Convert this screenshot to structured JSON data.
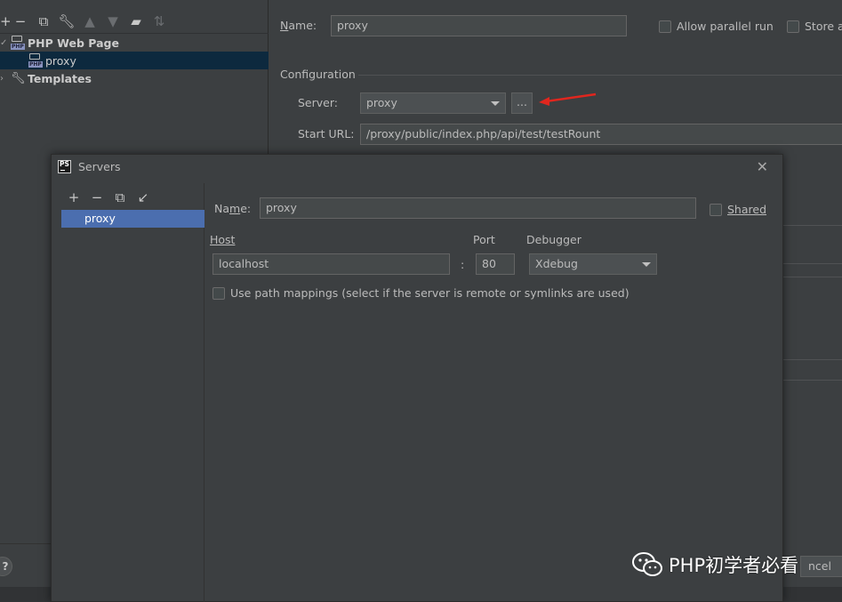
{
  "background_window": {
    "tree": {
      "toolbar_icons": [
        "add-icon",
        "remove-icon",
        "copy-icon",
        "wrench-icon",
        "move-up-icon",
        "move-down-icon",
        "new-folder-icon",
        "sort-icon"
      ],
      "items": [
        {
          "label": "PHP Web Page",
          "expanded": true
        },
        {
          "label": "proxy",
          "selected": true
        },
        {
          "label": "Templates",
          "expanded": false
        }
      ]
    },
    "form": {
      "name_label": "Name:",
      "name_value": "proxy",
      "allow_parallel_label": "Allow parallel run",
      "store_label": "Store a",
      "configuration_heading": "Configuration",
      "server_label": "Server:",
      "server_value": "proxy",
      "browse_button": "...",
      "start_url_label": "Start URL:",
      "start_url_value": "/proxy/public/index.php/api/test/testRount"
    },
    "help_label": "?",
    "cancel_fragment": "ncel",
    "annotation_arrow_color": "#e0261e"
  },
  "servers_dialog": {
    "title": "Servers",
    "toolbar_icons": [
      "add-icon",
      "remove-icon",
      "copy-icon",
      "import-icon"
    ],
    "list": [
      "proxy"
    ],
    "name_label": "Name:",
    "name_value": "proxy",
    "shared_label": "Shared",
    "host_label": "Host",
    "host_value": "localhost",
    "colon": ":",
    "port_label": "Port",
    "port_value": "80",
    "debugger_label": "Debugger",
    "debugger_value": "Xdebug",
    "path_mappings_label": "Use path mappings (select if the server is remote or symlinks are used)"
  },
  "watermark": {
    "text": "PHP初学者必看"
  },
  "colors": {
    "panel": "#3c3f41",
    "selection": "#4b6eaf",
    "tree_selection": "#0d293e",
    "field": "#45494a"
  }
}
